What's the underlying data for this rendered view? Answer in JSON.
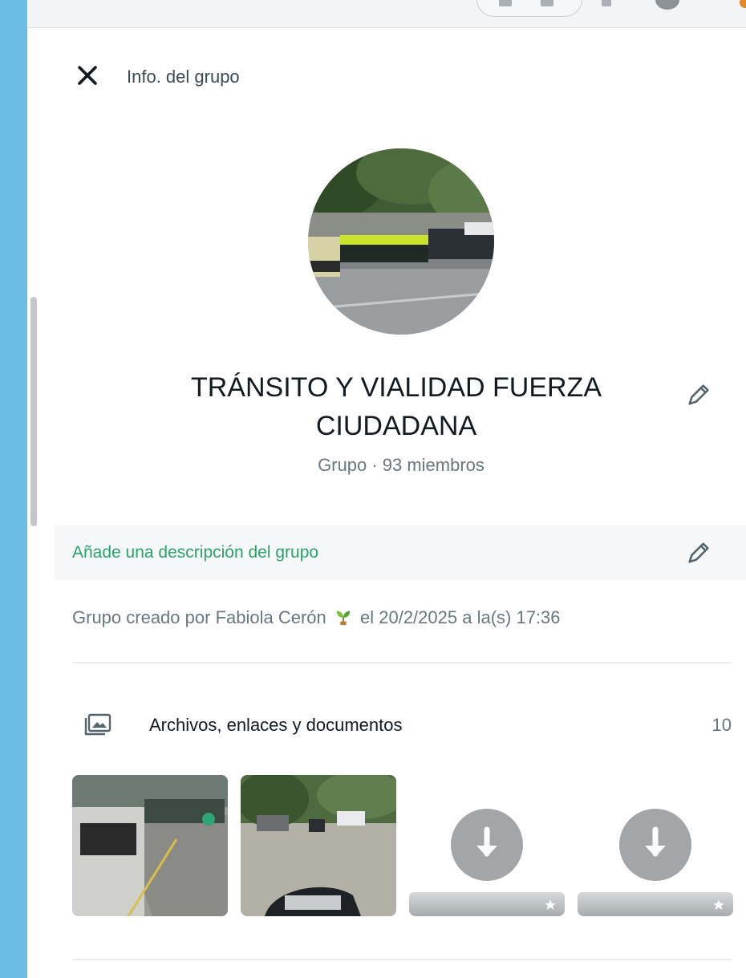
{
  "header": {
    "close_icon": "close-icon",
    "title": "Info. del grupo"
  },
  "group": {
    "name": "TRÁNSITO Y VIALIDAD FUERZA CIUDADANA",
    "subtitle": "Grupo · 93 miembros",
    "photo_icon": "group-photo"
  },
  "description": {
    "add_label": "Añade una descripción del grupo",
    "edit_icon": "pencil-icon"
  },
  "created": {
    "prefix": "Grupo creado por",
    "creator": "Fabiola Cerón",
    "emoji_icon": "plant-emoji-icon",
    "date": "el 20/2/2025 a la(s) 17:36"
  },
  "media": {
    "label": "Archivos, enlaces y documentos",
    "count": "10",
    "icon": "folder-image-icon",
    "items": [
      {
        "kind": "photo",
        "name": "street-photo"
      },
      {
        "kind": "photo",
        "name": "parking-photo"
      },
      {
        "kind": "download",
        "icon": "download-icon"
      },
      {
        "kind": "download",
        "icon": "download-icon"
      }
    ]
  },
  "colors": {
    "accent_green": "#2aa36b",
    "text_primary": "#111b21",
    "text_secondary": "#667781",
    "background": "#ffffff",
    "outer_background": "#6bbde6"
  }
}
